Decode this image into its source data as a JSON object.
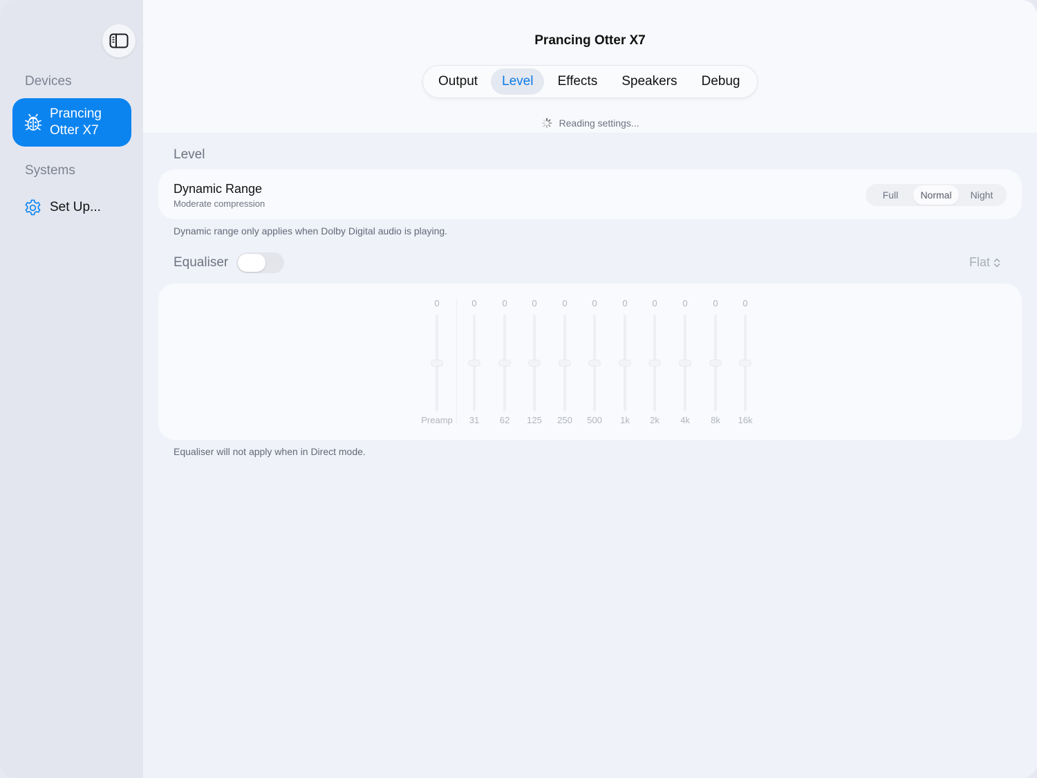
{
  "sidebar": {
    "devices_label": "Devices",
    "device": {
      "name": "Prancing Otter X7",
      "icon": "ladybug-icon"
    },
    "systems_label": "Systems",
    "setup": {
      "label": "Set Up...",
      "icon": "gear-icon"
    }
  },
  "header": {
    "title": "Prancing Otter X7",
    "tabs": [
      "Output",
      "Level",
      "Effects",
      "Speakers",
      "Debug"
    ],
    "active_tab": "Level",
    "status": "Reading settings..."
  },
  "level": {
    "section_title": "Level",
    "dynamic_range": {
      "title": "Dynamic Range",
      "subtitle": "Moderate compression",
      "options": [
        "Full",
        "Normal",
        "Night"
      ],
      "selected": "Normal"
    },
    "dynamic_range_note": "Dynamic range only applies when Dolby Digital audio is playing."
  },
  "equaliser": {
    "label": "Equaliser",
    "enabled": false,
    "preset": "Flat",
    "bands": [
      {
        "label": "Preamp",
        "value": "0"
      },
      {
        "label": "31",
        "value": "0"
      },
      {
        "label": "62",
        "value": "0"
      },
      {
        "label": "125",
        "value": "0"
      },
      {
        "label": "250",
        "value": "0"
      },
      {
        "label": "500",
        "value": "0"
      },
      {
        "label": "1k",
        "value": "0"
      },
      {
        "label": "2k",
        "value": "0"
      },
      {
        "label": "4k",
        "value": "0"
      },
      {
        "label": "8k",
        "value": "0"
      },
      {
        "label": "16k",
        "value": "0"
      }
    ],
    "note": "Equaliser will not apply when in Direct mode."
  },
  "colors": {
    "accent": "#0b84f0",
    "sidebar_bg": "#e3e6ef",
    "content_bg": "#eff2f9"
  }
}
